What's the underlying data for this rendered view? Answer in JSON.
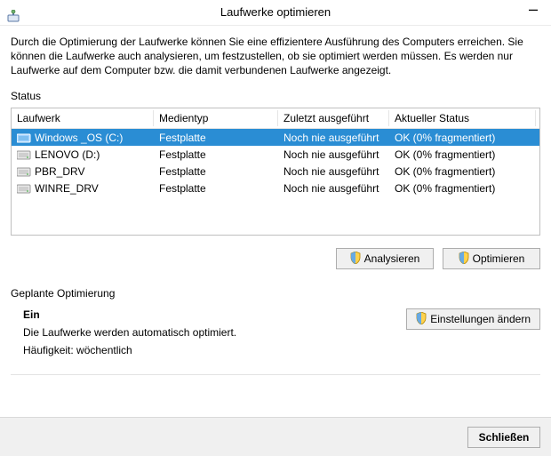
{
  "window": {
    "title": "Laufwerke optimieren"
  },
  "intro": "Durch die Optimierung der Laufwerke können Sie eine effizientere Ausführung des Computers erreichen. Sie können die Laufwerke auch analysieren, um festzustellen, ob sie optimiert werden müssen. Es werden nur Laufwerke auf dem Computer bzw. die damit verbundenen Laufwerke angezeigt.",
  "status_label": "Status",
  "columns": {
    "drive": "Laufwerk",
    "media": "Medientyp",
    "last": "Zuletzt ausgeführt",
    "status": "Aktueller Status"
  },
  "drives": [
    {
      "name": "Windows _OS (C:)",
      "media": "Festplatte",
      "last": "Noch nie ausgeführt",
      "status": "OK (0% fragmentiert)",
      "selected": true,
      "icon": "drive-primary"
    },
    {
      "name": "LENOVO (D:)",
      "media": "Festplatte",
      "last": "Noch nie ausgeführt",
      "status": "OK (0% fragmentiert)",
      "selected": false,
      "icon": "drive"
    },
    {
      "name": "PBR_DRV",
      "media": "Festplatte",
      "last": "Noch nie ausgeführt",
      "status": "OK (0% fragmentiert)",
      "selected": false,
      "icon": "drive"
    },
    {
      "name": "WINRE_DRV",
      "media": "Festplatte",
      "last": "Noch nie ausgeführt",
      "status": "OK (0% fragmentiert)",
      "selected": false,
      "icon": "drive"
    }
  ],
  "buttons": {
    "analyze": "Analysieren",
    "optimize": "Optimieren",
    "change_settings": "Einstellungen ändern",
    "close": "Schließen"
  },
  "schedule": {
    "header": "Geplante Optimierung",
    "state": "Ein",
    "auto_text": "Die Laufwerke werden automatisch optimiert.",
    "frequency": "Häufigkeit: wöchentlich"
  }
}
